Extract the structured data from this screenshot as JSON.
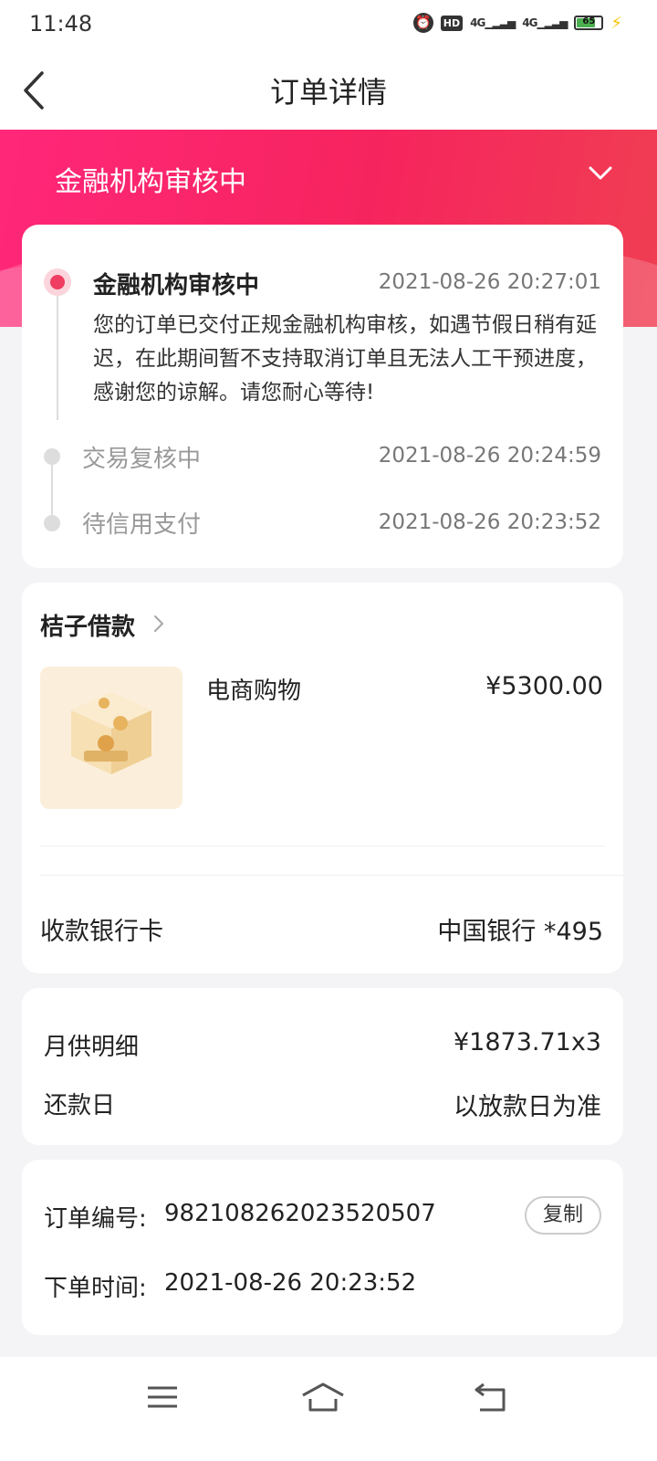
{
  "status_bar": {
    "time": "11:48",
    "network": "4G",
    "battery": "65",
    "icons": [
      "alarm-icon",
      "hd-icon",
      "signal-icon",
      "signal-icon",
      "battery-icon",
      "charging-icon"
    ]
  },
  "header": {
    "title": "订单详情",
    "back_icon": "chevron-left-icon"
  },
  "hero": {
    "status": "金融机构审核中",
    "toggle_icon": "chevron-down-icon",
    "color_start": "#ff2779",
    "color_end": "#f03e52"
  },
  "timeline": {
    "current": {
      "title": "金融机构审核中",
      "time": "2021-08-26 20:27:01",
      "desc": "您的订单已交付正规金融机构审核，如遇节假日稍有延迟，在此期间暂不支持取消订单且无法人工干预进度，感谢您的谅解。请您耐心等待!"
    },
    "steps": [
      {
        "title": "交易复核中",
        "time": "2021-08-26 20:24:59"
      },
      {
        "title": "待信用支付",
        "time": "2021-08-26 20:23:52"
      }
    ]
  },
  "product": {
    "lender": "桔子借款",
    "name": "电商购物",
    "price": "¥5300.00",
    "bank_label": "收款银行卡",
    "bank_value": "中国银行 *495"
  },
  "repayment": {
    "monthly_label": "月供明细",
    "monthly_value": "¥1873.71x3",
    "day_label": "还款日",
    "day_value": "以放款日为准"
  },
  "order": {
    "number_label": "订单编号:",
    "number": "982108262023520507",
    "copy_label": "复制",
    "time_label": "下单时间:",
    "time": "2021-08-26 20:23:52"
  },
  "system_nav": {
    "icons": [
      "menu-icon",
      "home-icon",
      "back-icon"
    ]
  },
  "colors": {
    "accent": "#ef3e61",
    "background": "#f4f4f6"
  }
}
